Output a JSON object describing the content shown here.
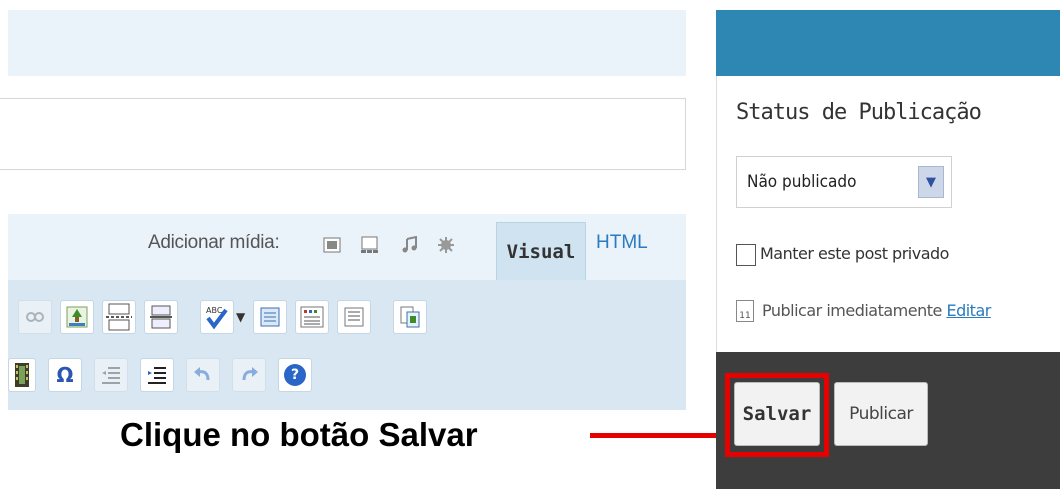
{
  "editor": {
    "media_label": "Adicionar mídia:",
    "media_icons": [
      "image-icon",
      "gallery-icon",
      "music-icon",
      "other-media-icon"
    ],
    "tabs": [
      {
        "label": "Visual",
        "active": true
      },
      {
        "label": "HTML",
        "active": false
      }
    ],
    "toolbar_row1_icons": [
      "unlink-icon",
      "insert-image-icon",
      "more-tag-icon",
      "page-break-icon",
      "spellcheck-icon",
      "fullscreen-icon",
      "kitchen-sink-icon",
      "paste-word-icon"
    ],
    "toolbar_row2_icons": [
      "media-icon",
      "special-char-icon",
      "outdent-icon",
      "indent-icon",
      "undo-icon",
      "redo-icon",
      "help-icon"
    ],
    "special_char_glyph": "Ω",
    "help_glyph": "?"
  },
  "annotation": {
    "text": "Clique no botão Salvar",
    "color": "#e60000"
  },
  "publish_panel": {
    "title": "Status de Publicação",
    "status_select": "Não publicado",
    "private_checkbox_label": "Manter este post privado",
    "private_checked": false,
    "publish_text": "Publicar imediatamente",
    "edit_link": "Editar",
    "calendar_day": "11",
    "save_button": "Salvar",
    "publish_button": "Publicar",
    "header_color": "#2e86b3",
    "footer_color": "#3d3d3d"
  }
}
